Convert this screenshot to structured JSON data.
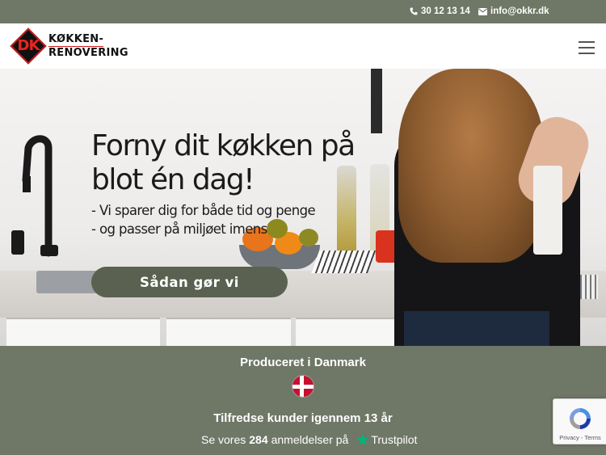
{
  "topbar": {
    "phone": "30 12 13 14",
    "email": "info@okkr.dk",
    "phone_icon": "phone-icon",
    "email_icon": "envelope-icon"
  },
  "header": {
    "logo_mark": "DK",
    "logo_line1": "KØKKEN-",
    "logo_line2": "RENOVERING",
    "menu_icon": "hamburger-menu-icon"
  },
  "hero": {
    "headline": "Forny dit køkken på blot én dag!",
    "sub_line1": "- Vi sparer dig for både tid og penge",
    "sub_line2": "- og passer på miljøet imens",
    "cta_label": "Sådan gør vi"
  },
  "band": {
    "made_in": "Produceret i Danmark",
    "flag_icon": "danish-flag-icon",
    "satisfied": "Tilfredse kunder igennem 13 år",
    "reviews_prefix": "Se vores",
    "reviews_count": "284",
    "reviews_mid": "anmeldelser på",
    "trustpilot": "Trustpilot"
  },
  "recaptcha": {
    "links": "Privacy - Terms"
  },
  "colors": {
    "band": "#6f7766",
    "cta": "#5a6150",
    "trustpilot_star": "#00b67a",
    "logo_red": "#e8261c"
  }
}
